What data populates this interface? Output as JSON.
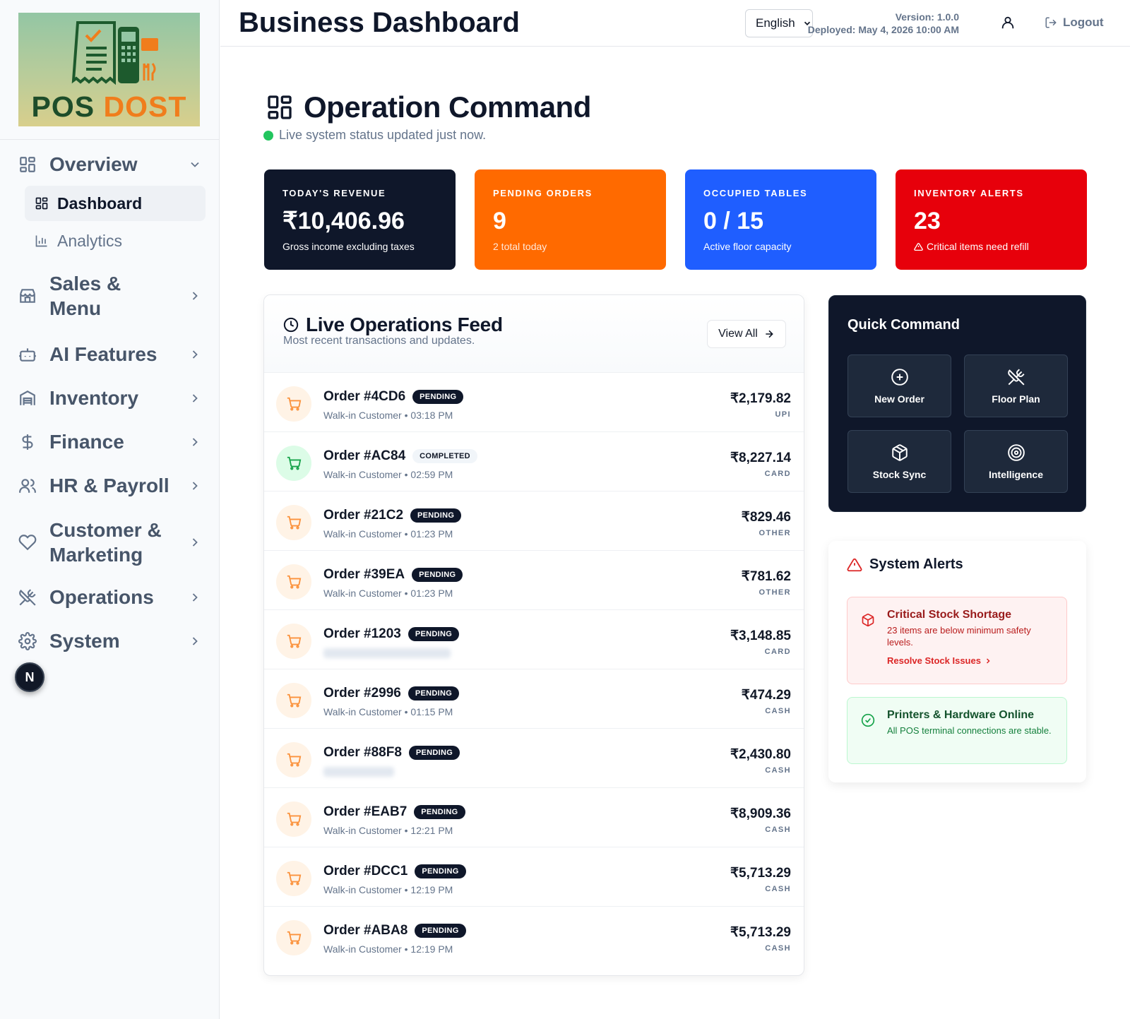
{
  "brand": {
    "logo_left": "POS",
    "logo_right": "DOST"
  },
  "sidebar": {
    "groups": [
      {
        "label": "Overview",
        "icon": "layout-grid-icon",
        "expanded": true
      },
      {
        "label": "Sales & Menu",
        "icon": "store-icon"
      },
      {
        "label": "AI Features",
        "icon": "bot-icon"
      },
      {
        "label": "Inventory",
        "icon": "warehouse-icon"
      },
      {
        "label": "Finance",
        "icon": "dollar-icon"
      },
      {
        "label": "HR & Payroll",
        "icon": "users-icon"
      },
      {
        "label": "Customer & Marketing",
        "icon": "heart-icon"
      },
      {
        "label": "Operations",
        "icon": "utensils-crossed-icon"
      },
      {
        "label": "System",
        "icon": "settings-icon"
      }
    ],
    "overview_items": [
      {
        "label": "Dashboard",
        "icon": "layout-grid-icon",
        "active": true
      },
      {
        "label": "Analytics",
        "icon": "bar-chart-icon",
        "active": false
      }
    ],
    "badge_letter": "N"
  },
  "header": {
    "title": "Business Dashboard",
    "language": "English",
    "version": "Version: 1.0.0",
    "deployed": "Deployed: May 4, 2026 10:00 AM",
    "logout": "Logout"
  },
  "operation": {
    "title": "Operation Command",
    "status": "Live system status updated just now.",
    "status_color": "#22c55e"
  },
  "stats": [
    {
      "title": "TODAY'S REVENUE",
      "value": "₹10,406.96",
      "sub": "Gross income excluding taxes",
      "color": "#0f172a"
    },
    {
      "title": "PENDING ORDERS",
      "value": "9",
      "sub": "2 total today",
      "color": "#ff6a00"
    },
    {
      "title": "OCCUPIED TABLES",
      "value": "0 / 15",
      "sub": "Active floor capacity",
      "color": "#1f5eff"
    },
    {
      "title": "INVENTORY ALERTS",
      "value": "23",
      "sub": "Critical items need refill",
      "color": "#e7000b"
    }
  ],
  "feed": {
    "title": "Live Operations Feed",
    "subtitle": "Most recent transactions and updates.",
    "view_all": "View All",
    "orders": [
      {
        "id": "Order #4CD6",
        "status": "PENDING",
        "meta": "Walk-in Customer • 03:18 PM",
        "amount": "₹2,179.82",
        "pay": "UPI"
      },
      {
        "id": "Order #AC84",
        "status": "COMPLETED",
        "meta": "Walk-in Customer • 02:59 PM",
        "amount": "₹8,227.14",
        "pay": "CARD"
      },
      {
        "id": "Order #21C2",
        "status": "PENDING",
        "meta": "Walk-in Customer • 01:23 PM",
        "amount": "₹829.46",
        "pay": "OTHER"
      },
      {
        "id": "Order #39EA",
        "status": "PENDING",
        "meta": "Walk-in Customer • 01:23 PM",
        "amount": "₹781.62",
        "pay": "OTHER"
      },
      {
        "id": "Order #1203",
        "status": "PENDING",
        "meta": "",
        "amount": "₹3,148.85",
        "pay": "CARD"
      },
      {
        "id": "Order #2996",
        "status": "PENDING",
        "meta": "Walk-in Customer • 01:15 PM",
        "amount": "₹474.29",
        "pay": "CASH"
      },
      {
        "id": "Order #88F8",
        "status": "PENDING",
        "meta": "",
        "amount": "₹2,430.80",
        "pay": "CASH"
      },
      {
        "id": "Order #EAB7",
        "status": "PENDING",
        "meta": "Walk-in Customer • 12:21 PM",
        "amount": "₹8,909.36",
        "pay": "CASH"
      },
      {
        "id": "Order #DCC1",
        "status": "PENDING",
        "meta": "Walk-in Customer • 12:19 PM",
        "amount": "₹5,713.29",
        "pay": "CASH"
      },
      {
        "id": "Order #ABA8",
        "status": "PENDING",
        "meta": "Walk-in Customer • 12:19 PM",
        "amount": "₹5,713.29",
        "pay": "CASH"
      }
    ]
  },
  "quick": {
    "title": "Quick Command",
    "buttons": [
      {
        "label": "New Order",
        "icon": "plus-circle-icon"
      },
      {
        "label": "Floor Plan",
        "icon": "utensils-crossed-icon"
      },
      {
        "label": "Stock Sync",
        "icon": "package-icon"
      },
      {
        "label": "Intelligence",
        "icon": "target-icon"
      }
    ]
  },
  "alerts": {
    "title": "System Alerts",
    "items": [
      {
        "title": "Critical Stock Shortage",
        "desc": "23 items are below minimum safety levels.",
        "link": "Resolve Stock Issues",
        "tone": "danger"
      },
      {
        "title": "Printers & Hardware Online",
        "desc": "All POS terminal connections are stable.",
        "link": "",
        "tone": "ok"
      }
    ]
  }
}
